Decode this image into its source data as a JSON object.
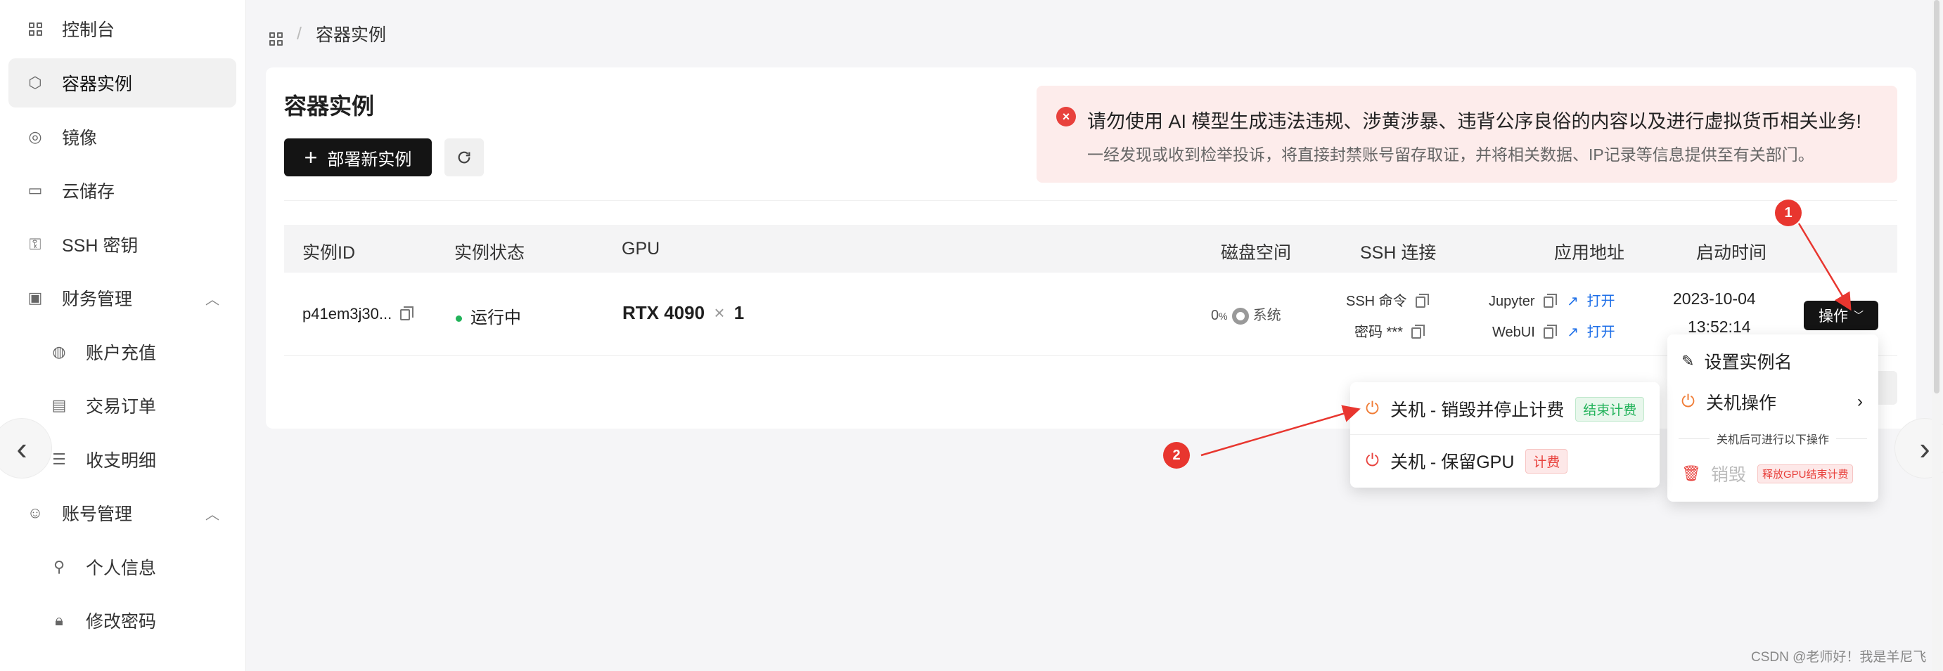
{
  "sidebar": {
    "items": [
      {
        "label": "控制台",
        "icon": "dashboard-icon"
      },
      {
        "label": "容器实例",
        "icon": "cube-icon"
      },
      {
        "label": "镜像",
        "icon": "disc-icon"
      },
      {
        "label": "云储存",
        "icon": "storage-icon"
      },
      {
        "label": "SSH 密钥",
        "icon": "key-icon"
      },
      {
        "label": "财务管理",
        "icon": "wallet-icon"
      },
      {
        "label": "账户充值",
        "icon": "recharge-icon"
      },
      {
        "label": "交易订单",
        "icon": "order-icon"
      },
      {
        "label": "收支明细",
        "icon": "list-icon"
      },
      {
        "label": "账号管理",
        "icon": "smile-icon"
      },
      {
        "label": "个人信息",
        "icon": "user-icon"
      },
      {
        "label": "修改密码",
        "icon": "lock-icon"
      }
    ]
  },
  "breadcrumb": {
    "current": "容器实例",
    "sep": "/"
  },
  "page": {
    "title": "容器实例",
    "deploy_label": "部署新实例"
  },
  "alert": {
    "title": "请勿使用 AI 模型生成违法违规、涉黄涉暴、违背公序良俗的内容以及进行虚拟货币相关业务!",
    "desc": "一经发现或收到检举投诉，将直接封禁账号留存取证，并将相关数据、IP记录等信息提供至有关部门。",
    "color": "#e8413c"
  },
  "table": {
    "headers": {
      "id": "实例ID",
      "status": "实例状态",
      "gpu": "GPU",
      "disk": "磁盘空间",
      "ssh": "SSH 连接",
      "app": "应用地址",
      "start": "启动时间"
    },
    "row": {
      "id": "p41em3j30...",
      "status": "运行中",
      "gpu_name": "RTX 4090",
      "gpu_x": "×",
      "gpu_count": "1",
      "disk_pct": "0",
      "disk_unit": "%",
      "disk_label": "系统",
      "ssh_cmd": "SSH 命令",
      "ssh_pwd": "密码 ***",
      "app1": "Jupyter",
      "app2": "WebUI",
      "open": "打开",
      "date": "2023-10-04",
      "time": "13:52:14",
      "op_label": "操作"
    }
  },
  "menu_right": {
    "rename": "设置实例名",
    "shutdown": "关机操作",
    "hint": "关机后可进行以下操作",
    "destroy": "销毁",
    "destroy_tag": "释放GPU结束计费"
  },
  "menu_left": {
    "opt1": "关机 - 销毁并停止计费",
    "opt1_tag": "结束计费",
    "opt2": "关机 - 保留GPU",
    "opt2_tag": "计费"
  },
  "markers": {
    "m1": "1",
    "m2": "2"
  },
  "watermark": "CSDN @老师好！我是羊尼飞"
}
